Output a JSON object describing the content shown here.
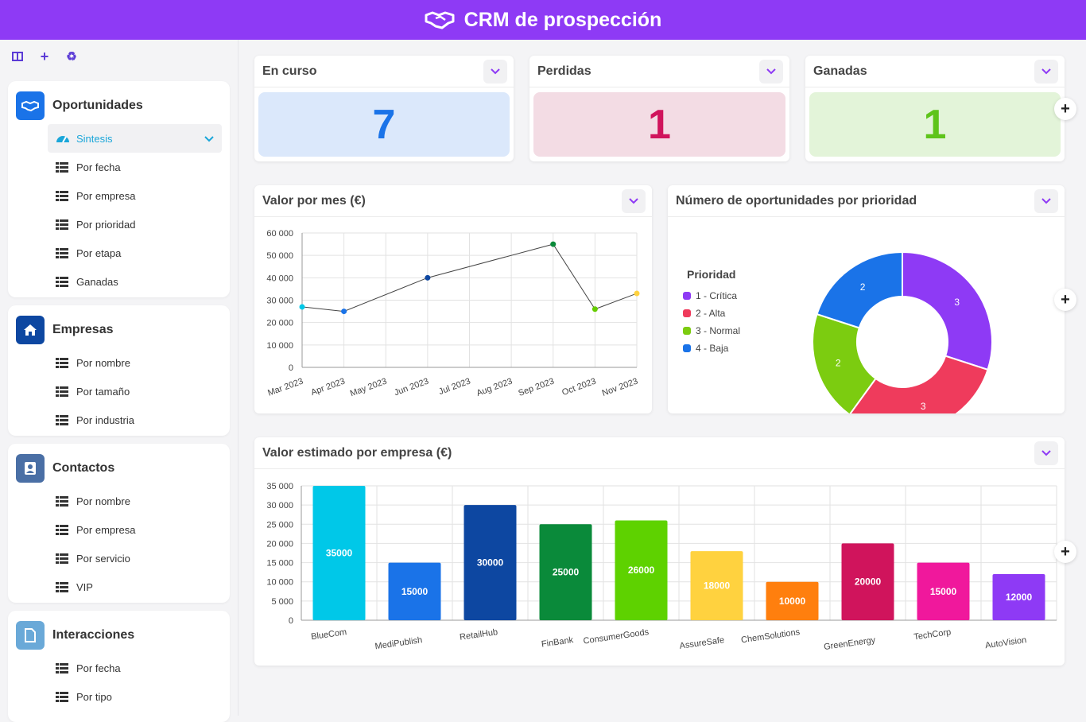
{
  "app": {
    "title": "CRM de prospección"
  },
  "toolbar": {
    "icons": [
      "columns-icon",
      "plus-icon",
      "recycle-icon"
    ]
  },
  "sidebar": {
    "sections": [
      {
        "title": "Oportunidades",
        "color": "#1a73e8",
        "items": [
          "Sintesis",
          "Por fecha",
          "Por empresa",
          "Por prioridad",
          "Por etapa",
          "Ganadas"
        ],
        "active": "Sintesis"
      },
      {
        "title": "Empresas",
        "color": "#0d47a1",
        "items": [
          "Por nombre",
          "Por tamaño",
          "Por industria"
        ]
      },
      {
        "title": "Contactos",
        "color": "#4a6fa5",
        "items": [
          "Por nombre",
          "Por empresa",
          "Por servicio",
          "VIP"
        ]
      },
      {
        "title": "Interacciones",
        "color": "#6aa9d8",
        "items": [
          "Por fecha",
          "Por tipo"
        ]
      }
    ]
  },
  "kpis": [
    {
      "label": "En curso",
      "value": "7",
      "bg": "#dbe8fb",
      "color": "#1a73e8"
    },
    {
      "label": "Perdidas",
      "value": "1",
      "bg": "#f3dce4",
      "color": "#d0145c"
    },
    {
      "label": "Ganadas",
      "value": "1",
      "bg": "#e3f4d9",
      "color": "#5ec41a"
    }
  ],
  "cards": {
    "line_title": "Valor por mes (€)",
    "donut_title": "Número de oportunidades por prioridad",
    "bar_title": "Valor estimado por empresa (€)"
  },
  "chart_data": [
    {
      "type": "line",
      "title": "Valor por mes (€)",
      "categories": [
        "Mar 2023",
        "Apr 2023",
        "May 2023",
        "Jun 2023",
        "Jul 2023",
        "Aug 2023",
        "Sep 2023",
        "Oct 2023",
        "Nov 2023"
      ],
      "points": [
        {
          "x": "Mar 2023",
          "y": 27000,
          "color": "#00c8e8"
        },
        {
          "x": "Apr 2023",
          "y": 25000,
          "color": "#1a73e8"
        },
        {
          "x": "Jun 2023",
          "y": 40000,
          "color": "#0d47a1"
        },
        {
          "x": "Sep 2023",
          "y": 55000,
          "color": "#0a8a3a"
        },
        {
          "x": "Oct 2023",
          "y": 26000,
          "color": "#66cc00"
        },
        {
          "x": "Nov 2023",
          "y": 33000,
          "color": "#ffd23f"
        }
      ],
      "yticks": [
        "0",
        "10 000",
        "20 000",
        "30 000",
        "40 000",
        "50 000",
        "60 000"
      ],
      "ylim": [
        0,
        60000
      ],
      "grid": true
    },
    {
      "type": "pie",
      "title": "Número de oportunidades por prioridad",
      "legend_title": "Prioridad",
      "legend_position": "left",
      "slices": [
        {
          "label": "1 - Crítica",
          "value": 3,
          "color": "#8e3af5"
        },
        {
          "label": "2 - Alta",
          "value": 3,
          "color": "#ef3b5c"
        },
        {
          "label": "3 - Normal",
          "value": 2,
          "color": "#7ccc10"
        },
        {
          "label": "4 - Baja",
          "value": 2,
          "color": "#1a73e8"
        }
      ]
    },
    {
      "type": "bar",
      "title": "Valor estimado por empresa (€)",
      "categories": [
        "BlueCom",
        "MediPublish",
        "RetailHub",
        "FinBank",
        "ConsumerGoods",
        "AssureSafe",
        "ChemSolutions",
        "GreenEnergy",
        "TechCorp",
        "AutoVision"
      ],
      "values": [
        35000,
        15000,
        30000,
        25000,
        26000,
        18000,
        10000,
        20000,
        15000,
        12000
      ],
      "colors": [
        "#00c8e8",
        "#1a73e8",
        "#0d47a1",
        "#0a8a3a",
        "#5ed200",
        "#ffd23f",
        "#ff7f0e",
        "#d0145c",
        "#f0189c",
        "#8e3af5"
      ],
      "yticks": [
        "0",
        "5 000",
        "10 000",
        "15 000",
        "20 000",
        "25 000",
        "30 000",
        "35 000"
      ],
      "ylim": [
        0,
        35000
      ],
      "grid": true
    }
  ]
}
